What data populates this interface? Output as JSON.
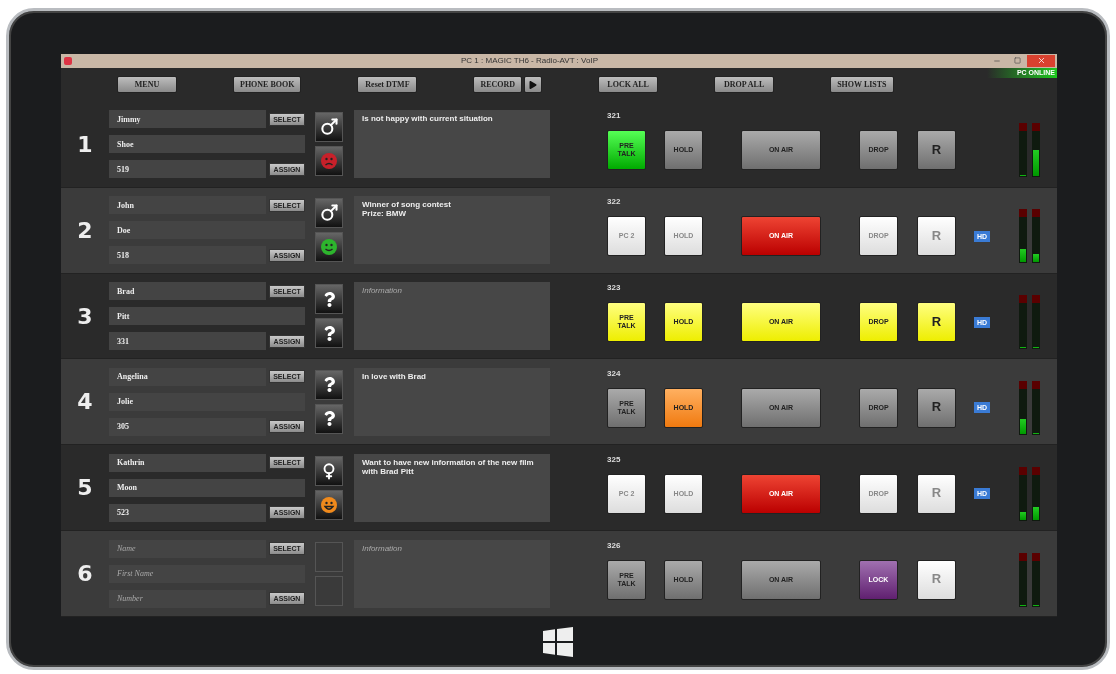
{
  "window": {
    "title": "PC 1 : MAGIC TH6 - Radio-AVT : VoIP"
  },
  "status": {
    "label": "PC ONLINE",
    "on": true
  },
  "toolbar": [
    {
      "label": "MENU",
      "kind": "button"
    },
    {
      "label": "PHONE BOOK",
      "kind": "button"
    },
    {
      "label": "Reset DTMF",
      "kind": "button"
    },
    {
      "label": "RECORD",
      "kind": "record"
    },
    {
      "label": "LOCK ALL",
      "kind": "button"
    },
    {
      "label": "DROP ALL",
      "kind": "button"
    },
    {
      "label": "SHOW LISTS",
      "kind": "button"
    }
  ],
  "lines": [
    {
      "number": "1",
      "name": {
        "value": "Jimmy"
      },
      "first_name": {
        "value": "Shoe"
      },
      "phone": {
        "value": "519"
      },
      "select": "SELECT",
      "assign": "ASSIGN",
      "gender": {
        "kind": "male"
      },
      "mood": {
        "kind": "angry",
        "color": "#c8202a"
      },
      "info": {
        "value": "Is not happy with current situation"
      },
      "ext": "321",
      "buttons": [
        {
          "label": "PRE TALK",
          "kind": "green"
        },
        {
          "label": "HOLD",
          "kind": "grey"
        },
        {
          "label": "ON AIR",
          "kind": "grey"
        },
        {
          "label": "DROP",
          "kind": "grey"
        },
        {
          "label": "R",
          "kind": "grey"
        }
      ],
      "meters": [
        {
          "level": 0
        },
        {
          "level": 0.5
        }
      ]
    },
    {
      "number": "2",
      "name": {
        "value": "John"
      },
      "first_name": {
        "value": "Doe"
      },
      "phone": {
        "value": "518"
      },
      "select": "SELECT",
      "assign": "ASSIGN",
      "gender": {
        "kind": "male"
      },
      "mood": {
        "kind": "happy",
        "color": "#2db52d"
      },
      "info": {
        "value": "Winner of song contest\nPrize: BMW"
      },
      "ext": "322",
      "buttons": [
        {
          "label": "PC 2",
          "kind": "disabled"
        },
        {
          "label": "HOLD",
          "kind": "disabled"
        },
        {
          "label": "ON AIR",
          "kind": "red"
        },
        {
          "label": "DROP",
          "kind": "disabled"
        },
        {
          "label": "R",
          "kind": "disabled"
        }
      ],
      "badge": "HD",
      "meters": [
        {
          "level": 0.25
        },
        {
          "level": 0.15
        }
      ]
    },
    {
      "number": "3",
      "name": {
        "value": "Brad"
      },
      "first_name": {
        "value": "Pitt"
      },
      "phone": {
        "value": "331"
      },
      "select": "SELECT",
      "assign": "ASSIGN",
      "gender": {
        "kind": "unknown"
      },
      "mood": {
        "kind": "unknown"
      },
      "info": {
        "placeholder": "Information"
      },
      "ext": "323",
      "buttons": [
        {
          "label": "PRE TALK",
          "kind": "yellow"
        },
        {
          "label": "HOLD",
          "kind": "yellow"
        },
        {
          "label": "ON AIR",
          "kind": "yellow"
        },
        {
          "label": "DROP",
          "kind": "yellow"
        },
        {
          "label": "R",
          "kind": "yellow"
        }
      ],
      "badge": "HD",
      "meters": [
        {
          "level": 0
        },
        {
          "level": 0
        }
      ]
    },
    {
      "number": "4",
      "name": {
        "value": "Angelina"
      },
      "first_name": {
        "value": "Jolie"
      },
      "phone": {
        "value": "305"
      },
      "select": "SELECT",
      "assign": "ASSIGN",
      "gender": {
        "kind": "unknown"
      },
      "mood": {
        "kind": "unknown"
      },
      "info": {
        "value": "In love with Brad"
      },
      "ext": "324",
      "buttons": [
        {
          "label": "PRE TALK",
          "kind": "grey"
        },
        {
          "label": "HOLD",
          "kind": "orange"
        },
        {
          "label": "ON AIR",
          "kind": "grey"
        },
        {
          "label": "DROP",
          "kind": "grey"
        },
        {
          "label": "R",
          "kind": "grey"
        }
      ],
      "badge": "HD",
      "meters": [
        {
          "level": 0.28
        },
        {
          "level": 0
        }
      ]
    },
    {
      "number": "5",
      "name": {
        "value": "Kathrin"
      },
      "first_name": {
        "value": "Moon"
      },
      "phone": {
        "value": "523"
      },
      "select": "SELECT",
      "assign": "ASSIGN",
      "gender": {
        "kind": "female"
      },
      "mood": {
        "kind": "laughing",
        "color": "#f08a1c"
      },
      "info": {
        "value": "Want to have new information of the new film with Brad Pitt"
      },
      "ext": "325",
      "buttons": [
        {
          "label": "PC 2",
          "kind": "disabled"
        },
        {
          "label": "HOLD",
          "kind": "disabled"
        },
        {
          "label": "ON AIR",
          "kind": "red"
        },
        {
          "label": "DROP",
          "kind": "disabled"
        },
        {
          "label": "R",
          "kind": "disabled"
        }
      ],
      "badge": "HD",
      "meters": [
        {
          "level": 0.15
        },
        {
          "level": 0.25
        }
      ]
    },
    {
      "number": "6",
      "name": {
        "placeholder": "Name"
      },
      "first_name": {
        "placeholder": "First Name"
      },
      "phone": {
        "placeholder": "Number"
      },
      "select": "SELECT",
      "assign": "ASSIGN",
      "gender": {
        "kind": "none"
      },
      "mood": {
        "kind": "none"
      },
      "info": {
        "placeholder": "Information"
      },
      "ext": "326",
      "buttons": [
        {
          "label": "PRE TALK",
          "kind": "grey"
        },
        {
          "label": "HOLD",
          "kind": "grey"
        },
        {
          "label": "ON AIR",
          "kind": "grey"
        },
        {
          "label": "LOCK",
          "kind": "purple"
        },
        {
          "label": "R",
          "kind": "disabled"
        }
      ],
      "meters": [
        {
          "level": 0
        },
        {
          "level": 0
        }
      ]
    }
  ]
}
